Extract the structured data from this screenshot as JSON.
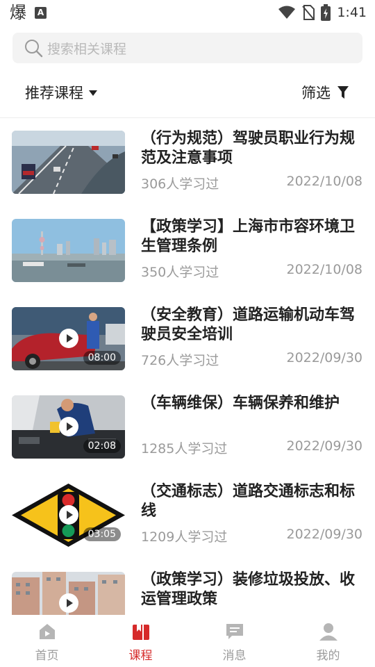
{
  "status_bar": {
    "left_glyph": "爆",
    "a_badge": "A",
    "time": "1:41"
  },
  "search": {
    "placeholder": "搜索相关课程"
  },
  "filters": {
    "sort_label": "推荐课程",
    "filter_label": "筛选"
  },
  "courses": [
    {
      "title": "（行为规范）驾驶员职业行为规范及注意事项",
      "learners": "306人学习过",
      "date": "2022/10/08",
      "duration": "",
      "thumb": "highway"
    },
    {
      "title": "【政策学习】上海市市容环境卫生管理条例",
      "learners": "350人学习过",
      "date": "2022/10/08",
      "duration": "",
      "thumb": "skyline"
    },
    {
      "title": "（安全教育）道路运输机动车驾驶员安全培训",
      "learners": "726人学习过",
      "date": "2022/09/30",
      "duration": "08:00",
      "thumb": "car"
    },
    {
      "title": "（车辆维保）车辆保养和维护",
      "learners": "1285人学习过",
      "date": "2022/09/30",
      "duration": "02:08",
      "thumb": "engine"
    },
    {
      "title": "（交通标志）道路交通标志和标线",
      "learners": "1209人学习过",
      "date": "2022/09/30",
      "duration": "03:05",
      "thumb": "traffic-sign"
    },
    {
      "title": "（政策学习）装修垃圾投放、收运管理政策",
      "learners": "",
      "date": "",
      "duration": "",
      "thumb": "buildings"
    }
  ],
  "nav": [
    {
      "label": "首页",
      "icon": "home-icon",
      "active": false
    },
    {
      "label": "课程",
      "icon": "course-icon",
      "active": true
    },
    {
      "label": "消息",
      "icon": "message-icon",
      "active": false
    },
    {
      "label": "我的",
      "icon": "profile-icon",
      "active": false
    }
  ],
  "colors": {
    "accent": "#d62a2a",
    "muted": "#9a9a9a",
    "search_bg": "#f3f3f3"
  }
}
